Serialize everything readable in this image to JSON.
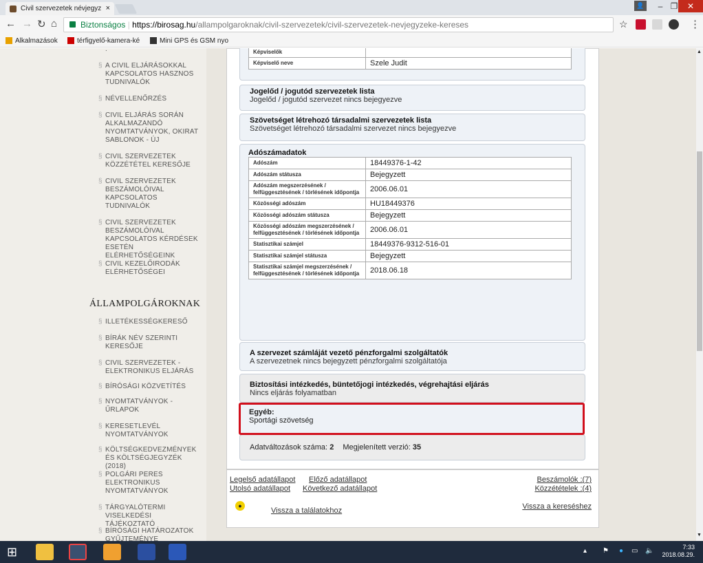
{
  "browser": {
    "tab_title": "Civil szervezetek névjegyz",
    "tab_close": "×",
    "secure_label": "Biztonságos",
    "url_domain": "https://birosag.hu",
    "url_path": "/allampolgaroknak/civil-szervezetek/civil-szervezetek-nevjegyzeke-kereses",
    "bookmarks": [
      "Alkalmazások",
      "térfigyelő-kamera-ké",
      "Mini GPS és GSM nyo"
    ],
    "minimize": "–",
    "restore": "❐",
    "close": "✕"
  },
  "sidebar": {
    "items": [
      "A CIVIL ELJÁRÁSOKKAL KAPCSOLATOS HASZNOS TUDNIVALÓK",
      "NÉVELLENŐRZÉS",
      "CIVIL ELJÁRÁS SORÁN ALKALMAZANDÓ NYOMTATVÁNYOK, OKIRAT SABLONOK - ÚJ",
      "CIVIL SZERVEZETEK KÖZZÉTÉTEL KERESŐJE",
      "CIVIL SZERVEZETEK BESZÁMOLÓIVAL KAPCSOLATOS TUDNIVALÓK",
      "CIVIL SZERVEZETEK BESZÁMOLÓIVAL KAPCSOLATOS KÉRDÉSEK ESETÉN ELÉRHETŐSÉGEINK",
      "CIVIL KEZELŐIRODÁK ELÉRHETŐSÉGEI"
    ],
    "section_title": "ÁLLAMPOLGÁROKNAK",
    "section_items": [
      "ILLETÉKESSÉGKERESŐ",
      "BÍRÁK NÉV SZERINTI KERESŐJE",
      "CIVIL SZERVEZETEK - ELEKTRONIKUS ELJÁRÁS",
      "BÍRÓSÁGI KÖZVETÍTÉS",
      "NYOMTATVÁNYOK - ŰRLAPOK",
      "KERESETLEVÉL NYOMTATVÁNYOK",
      "KÖLTSÉGKEDVEZMÉNYEK ÉS KÖLTSÉGJEGYZÉK (2018)",
      "POLGÁRI PERES ELEKTRONIKUS NYOMTATVÁNYOK",
      "TÁRGYALÓTERMI VISELKEDÉSI TÁJÉKOZTATÓ",
      "BÍRÓSÁGI HATÁROZATOK GYŰJTEMÉNYE"
    ]
  },
  "main": {
    "rep_label": "Képviselő neve",
    "rep_value": "Szele Judit",
    "rep_top_label": "Képviselők",
    "predecessor_title": "Jogelőd / jogutód szervezetek lista",
    "predecessor_value": "Jogelőd / jogutód szervezet nincs bejegyezve",
    "federation_title": "Szövetséget létrehozó társadalmi szervezetek lista",
    "federation_value": "Szövetséget létrehozó társadalmi szervezet nincs bejegyezve",
    "tax_title": "Adószámadatok",
    "tax_rows": [
      {
        "label": "Adószám",
        "value": "18449376-1-42"
      },
      {
        "label": "Adószám státusza",
        "value": "Bejegyzett"
      },
      {
        "label": "Adószám megszerzésének / felfüggesztésének / törlésének időpontja",
        "value": "2006.06.01"
      },
      {
        "label": "Közösségi adószám",
        "value": "HU18449376"
      },
      {
        "label": "Közösségi adószám státusza",
        "value": "Bejegyzett"
      },
      {
        "label": "Közösségi adószám megszerzésének / felfüggesztésének / törlésének időpontja",
        "value": "2006.06.01"
      },
      {
        "label": "Statisztikai számjel",
        "value": "18449376-9312-516-01"
      },
      {
        "label": "Statisztikai számjel státusza",
        "value": "Bejegyzett"
      },
      {
        "label": "Statisztikai számjel megszerzésének / felfüggesztésének / törlésének időpontja",
        "value": "2018.06.18"
      }
    ],
    "payment_title": "A szervezet számláját vezető pénzforgalmi szolgáltatók",
    "payment_value": "A szervezetnek nincs bejegyzett pénzforgalmi szolgáltatója",
    "proceedings_title": "Biztosítási intézkedés, büntetőjogi intézkedés, végrehajtási eljárás",
    "proceedings_value": "Nincs eljárás folyamatban",
    "other_title": "Egyéb:",
    "other_value": "Sportági szövetség",
    "changes_label": "Adatváltozások száma:",
    "changes_count": "2",
    "version_label": "Megjelenített verzió:",
    "version_value": "35"
  },
  "links": {
    "first": "Legelső adatállapot",
    "prev": "Előző adatállapot",
    "last": "Utolsó adatállapot",
    "next": "Következő adatállapot",
    "reports": "Beszámolók :(7)",
    "publications": "Közzétételek :(4)",
    "back_results": "Vissza a találatokhoz",
    "back_search": "Vissza a kereséshez"
  },
  "taskbar": {
    "time": "7:33",
    "date": "2018.08.29."
  }
}
